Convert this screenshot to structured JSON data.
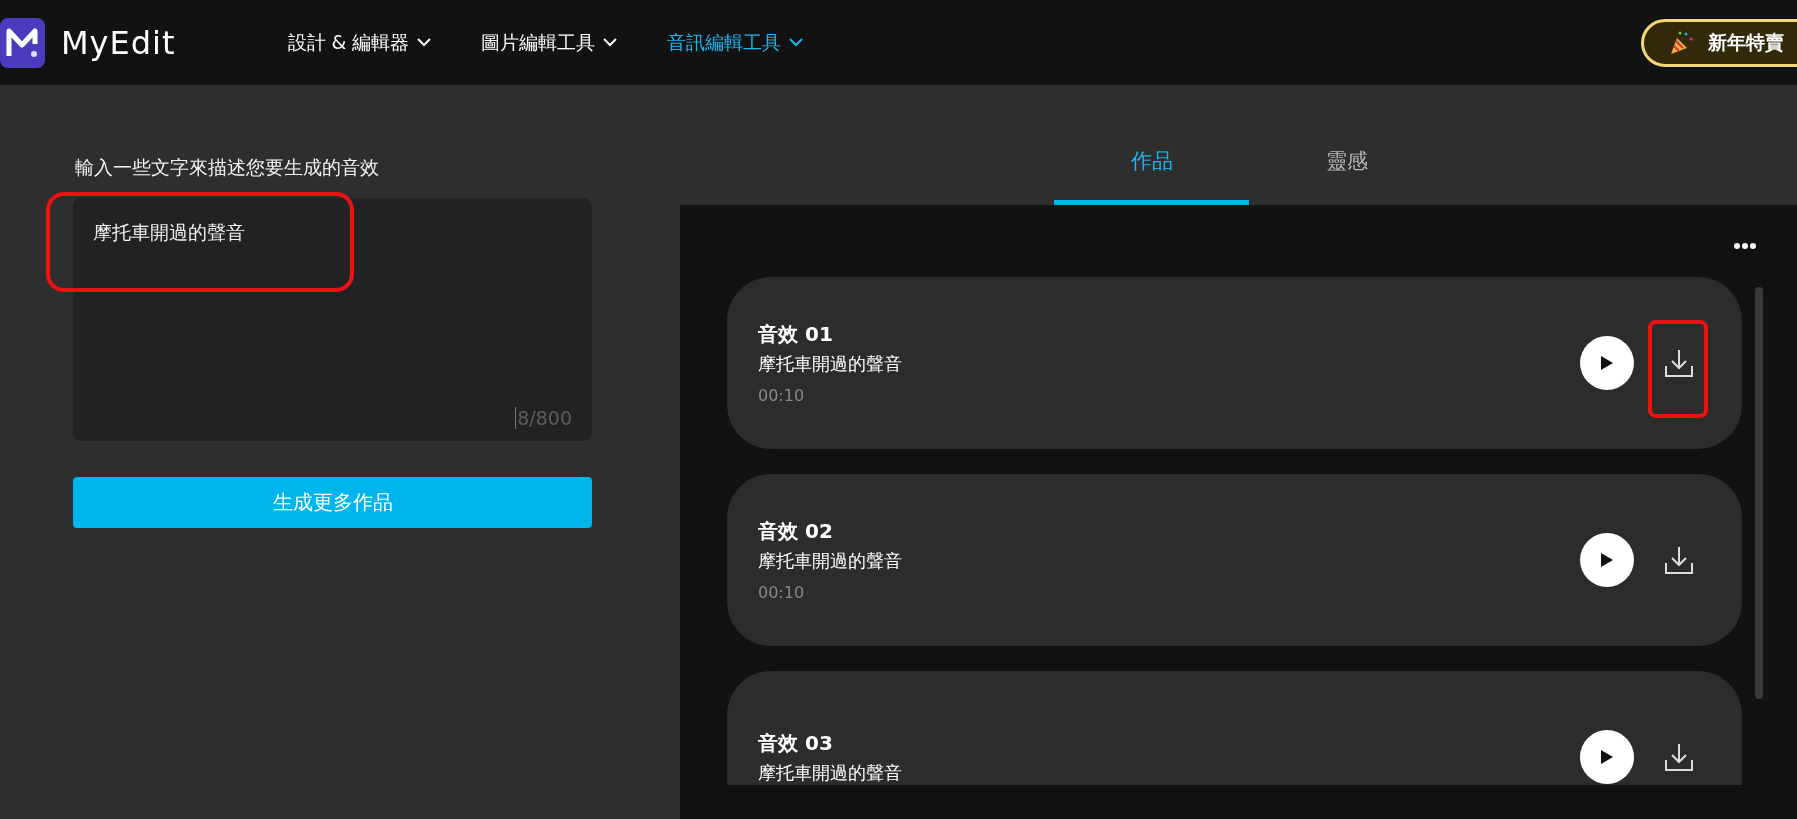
{
  "header": {
    "logo_text": "MyEdit",
    "nav": [
      {
        "label": "設計 & 編輯器",
        "selected": false
      },
      {
        "label": "圖片編輯工具",
        "selected": false
      },
      {
        "label": "音訊編輯工具",
        "selected": true
      }
    ],
    "promo": {
      "label": "新年特賣"
    }
  },
  "prompt": {
    "label": "輸入一些文字來描述您要生成的音效",
    "value": "摩托車開過的聲音",
    "counter": "8/800",
    "annotated": true,
    "button": "生成更多作品"
  },
  "tabs": [
    {
      "label": "作品",
      "selected": true
    },
    {
      "label": "靈感",
      "selected": false
    }
  ],
  "results": [
    {
      "title": "音效 01",
      "description": "摩托車開過的聲音",
      "duration": "00:10",
      "download_annotated": true
    },
    {
      "title": "音效 02",
      "description": "摩托車開過的聲音",
      "duration": "00:10",
      "download_annotated": false
    },
    {
      "title": "音效 03",
      "description": "摩托車開過的聲音",
      "download_annotated": false
    }
  ]
}
